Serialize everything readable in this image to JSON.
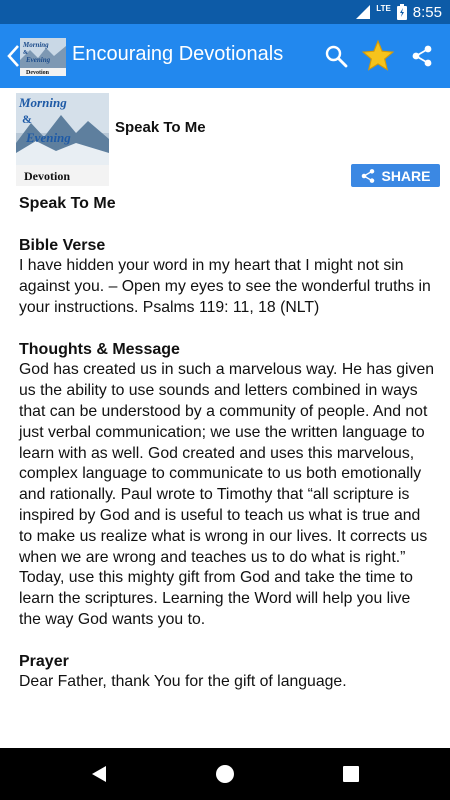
{
  "status_bar": {
    "network": "LTE",
    "time": "8:55"
  },
  "app_bar": {
    "title": "Encouraing Devotionals",
    "icons": [
      "back-icon",
      "search-icon",
      "star-icon",
      "share-icon"
    ],
    "logo_text": [
      "Morning",
      "&",
      "Evening",
      "Devotion"
    ],
    "colors": {
      "status": "#0d5ba7",
      "bar": "#2288ee",
      "star": "#f6c31c"
    }
  },
  "item": {
    "thumb_text": [
      "Morning",
      "&",
      "Evening",
      "Devotion"
    ],
    "title": "Speak To Me",
    "share_label": "SHARE"
  },
  "article": {
    "heading": "Speak To Me",
    "bible_heading": "Bible Verse",
    "bible_text": "I have hidden your word in my heart that I might not sin against you. – Open my eyes to see the wonderful truths in your instructions. Psalms 119: 11, 18 (NLT)",
    "thoughts_heading": "Thoughts & Message",
    "thoughts_text": "God has created us in such a marvelous way. He has given us the ability to use sounds and letters combined in ways that can be understood by a community of people. And not just verbal communication; we use the written language to learn with as well. God created and uses this marvelous, complex language to communicate to us both emotionally and rationally. Paul wrote to Timothy that “all scripture is inspired by God and is useful to teach us what is true and to make us realize what is wrong in our lives. It corrects us when we are wrong and teaches us to do what is right.” Today, use this mighty gift from God and take the time to learn the scriptures. Learning the Word will help you live the way God wants you to.",
    "prayer_heading": "Prayer",
    "prayer_text": "Dear Father, thank You for the gift of language."
  },
  "nav_bar": {
    "icons": [
      "back-triangle-icon",
      "home-circle-icon",
      "recents-square-icon"
    ]
  }
}
